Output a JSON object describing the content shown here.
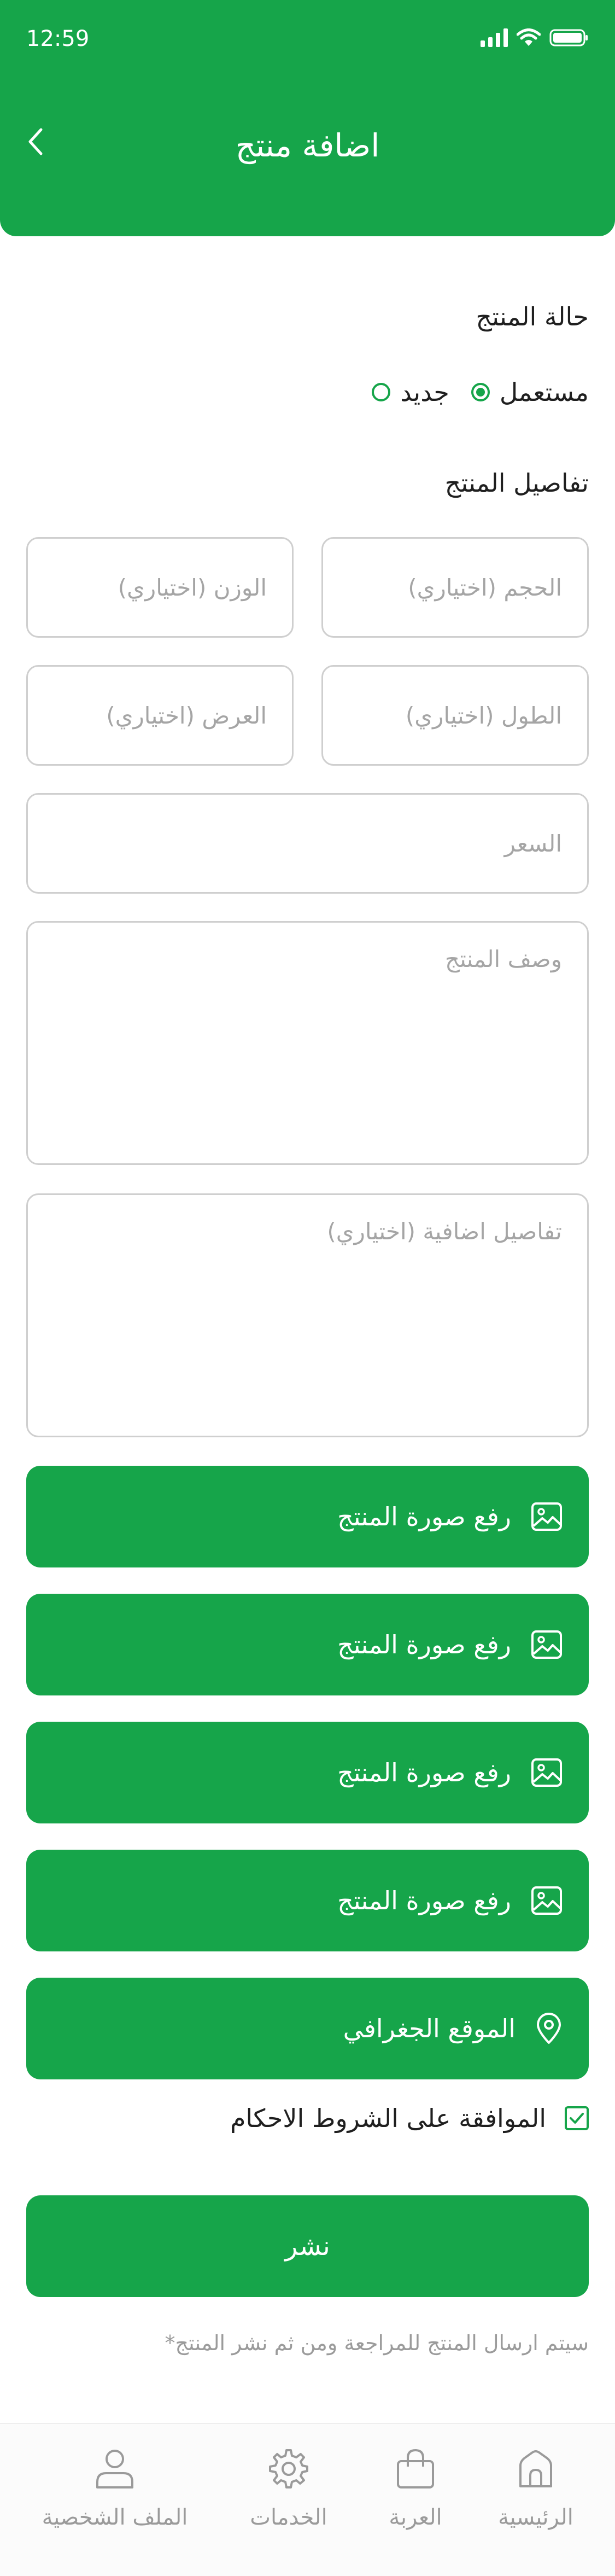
{
  "status_bar": {
    "time": "12:59"
  },
  "header": {
    "title": "اضافة منتج"
  },
  "condition": {
    "title": "حالة المنتج",
    "options": [
      {
        "label": "جديد",
        "selected": false
      },
      {
        "label": "مستعمل",
        "selected": true
      }
    ]
  },
  "details": {
    "title": "تفاصيل المنتج",
    "size_placeholder": "الحجم (اختياري)",
    "weight_placeholder": "الوزن (اختياري)",
    "length_placeholder": "الطول (اختياري)",
    "width_placeholder": "العرض (اختياري)",
    "price_placeholder": "السعر",
    "description_placeholder": "وصف المنتج",
    "extra_placeholder": "تفاصيل اضافية (اختياري)"
  },
  "uploads": [
    {
      "label": "رفع صورة المنتج",
      "icon": "image-icon"
    },
    {
      "label": "رفع صورة المنتج",
      "icon": "image-icon"
    },
    {
      "label": "رفع صورة المنتج",
      "icon": "image-icon"
    },
    {
      "label": "رفع صورة المنتج",
      "icon": "image-icon"
    }
  ],
  "location": {
    "label": "الموقع الجغرافي",
    "icon": "location-pin-icon"
  },
  "terms": {
    "label": "الموافقة على الشروط الاحكام",
    "checked": true
  },
  "publish": {
    "label": "نشر"
  },
  "note": "سيتم ارسال المنتج للمراجعة ومن ثم نشر المنتج*",
  "tabbar": {
    "home": "الرئيسية",
    "cart": "العربة",
    "services": "الخدمات",
    "profile": "الملف الشخصية"
  },
  "colors": {
    "accent": "#16a54a",
    "field_border": "#cfcfcf",
    "placeholder": "#a5a5a5"
  }
}
